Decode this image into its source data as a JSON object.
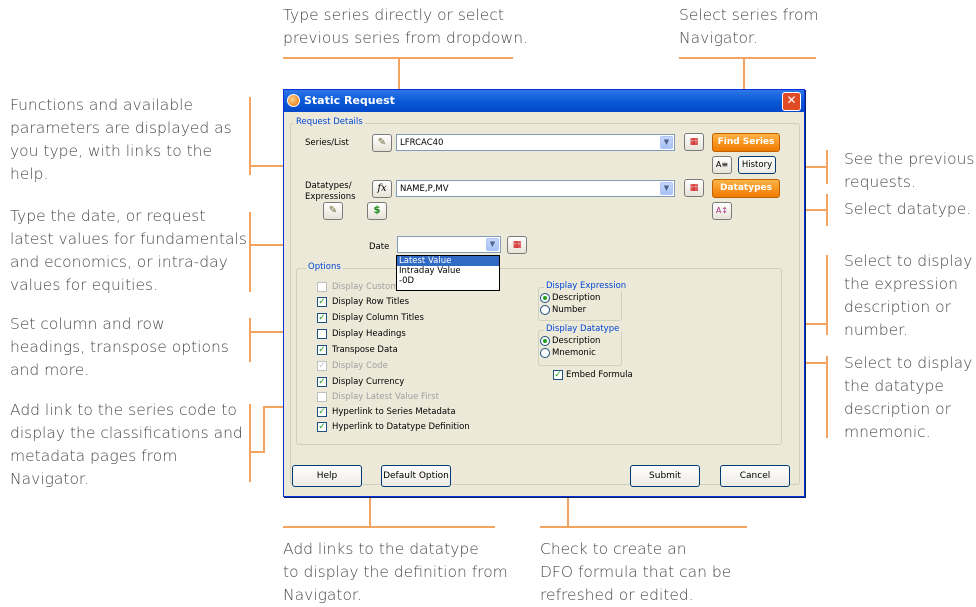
{
  "annotations": {
    "top_center": [
      "Type series directly or select",
      "previous series from dropdown."
    ],
    "top_right": [
      "Select series from",
      "Navigator."
    ],
    "left_1": [
      "Functions and available",
      "parameters are displayed as",
      "you type, with links to the",
      "help."
    ],
    "left_2": [
      "Type the date, or request",
      "latest values for fundamentals",
      "and economics, or intra-day",
      "values for equities."
    ],
    "left_3": [
      "Set column and row",
      "headings, transpose options",
      "and more."
    ],
    "left_4": [
      "Add link to the series code to",
      "display the classifications and",
      "metadata pages from",
      "Navigator."
    ],
    "right_1": [
      "See the previous",
      "requests."
    ],
    "right_2": [
      "Select datatype."
    ],
    "right_3": [
      "Select to display",
      "the expression",
      "description or",
      "number."
    ],
    "right_4": [
      "Select to display",
      "the datatype",
      "description or",
      "mnemonic."
    ],
    "bottom_center": [
      "Add links to the datatype",
      "to display the definition from",
      "Navigator."
    ],
    "bottom_right": [
      "Check to create an",
      "DFO formula that can be",
      "refreshed or edited."
    ]
  },
  "dialog": {
    "title": "Static Request",
    "close_glyph": "✕",
    "request_details_label": "Request Details",
    "series_label": "Series/List",
    "series_value": "LFRCAC40",
    "find_series_label": "Find Series",
    "history_label": "History",
    "datatypes_label_1": "Datatypes/",
    "datatypes_label_2": "Expressions",
    "datatypes_value": "NAME,P,MV",
    "datatypes_button_label": "Datatypes",
    "date_label": "Date",
    "date_options": [
      "Latest Value",
      "Intraday Value",
      "-0D"
    ],
    "options_label": "Options",
    "options": [
      {
        "label": "Display Custom",
        "checked": false,
        "disabled": true
      },
      {
        "label": "Display Row Titles",
        "checked": true,
        "disabled": false
      },
      {
        "label": "Display Column Titles",
        "checked": true,
        "disabled": false
      },
      {
        "label": "Display Headings",
        "checked": false,
        "disabled": false
      },
      {
        "label": "Transpose Data",
        "checked": true,
        "disabled": false
      },
      {
        "label": "Display Code",
        "checked": true,
        "disabled": true
      },
      {
        "label": "Display Currency",
        "checked": true,
        "disabled": false
      },
      {
        "label": "Display Latest Value First",
        "checked": false,
        "disabled": true
      },
      {
        "label": "Hyperlink to Series Metadata",
        "checked": true,
        "disabled": false
      },
      {
        "label": "Hyperlink to Datatype Definition",
        "checked": true,
        "disabled": false
      }
    ],
    "display_expression_label": "Display Expression",
    "expression_options": [
      {
        "label": "Description",
        "selected": true
      },
      {
        "label": "Number",
        "selected": false
      }
    ],
    "display_datatype_label": "Display Datatype",
    "datatype_options": [
      {
        "label": "Description",
        "selected": true
      },
      {
        "label": "Mnemonic",
        "selected": false
      }
    ],
    "embed_formula_label": "Embed Formula",
    "help_label": "Help",
    "default_option_label": "Default Option",
    "submit_label": "Submit",
    "cancel_label": "Cancel"
  },
  "colors": {
    "accent_line": "#f4a460",
    "orange_button": "#f07a00",
    "title_bar": "#0a5ad8"
  }
}
